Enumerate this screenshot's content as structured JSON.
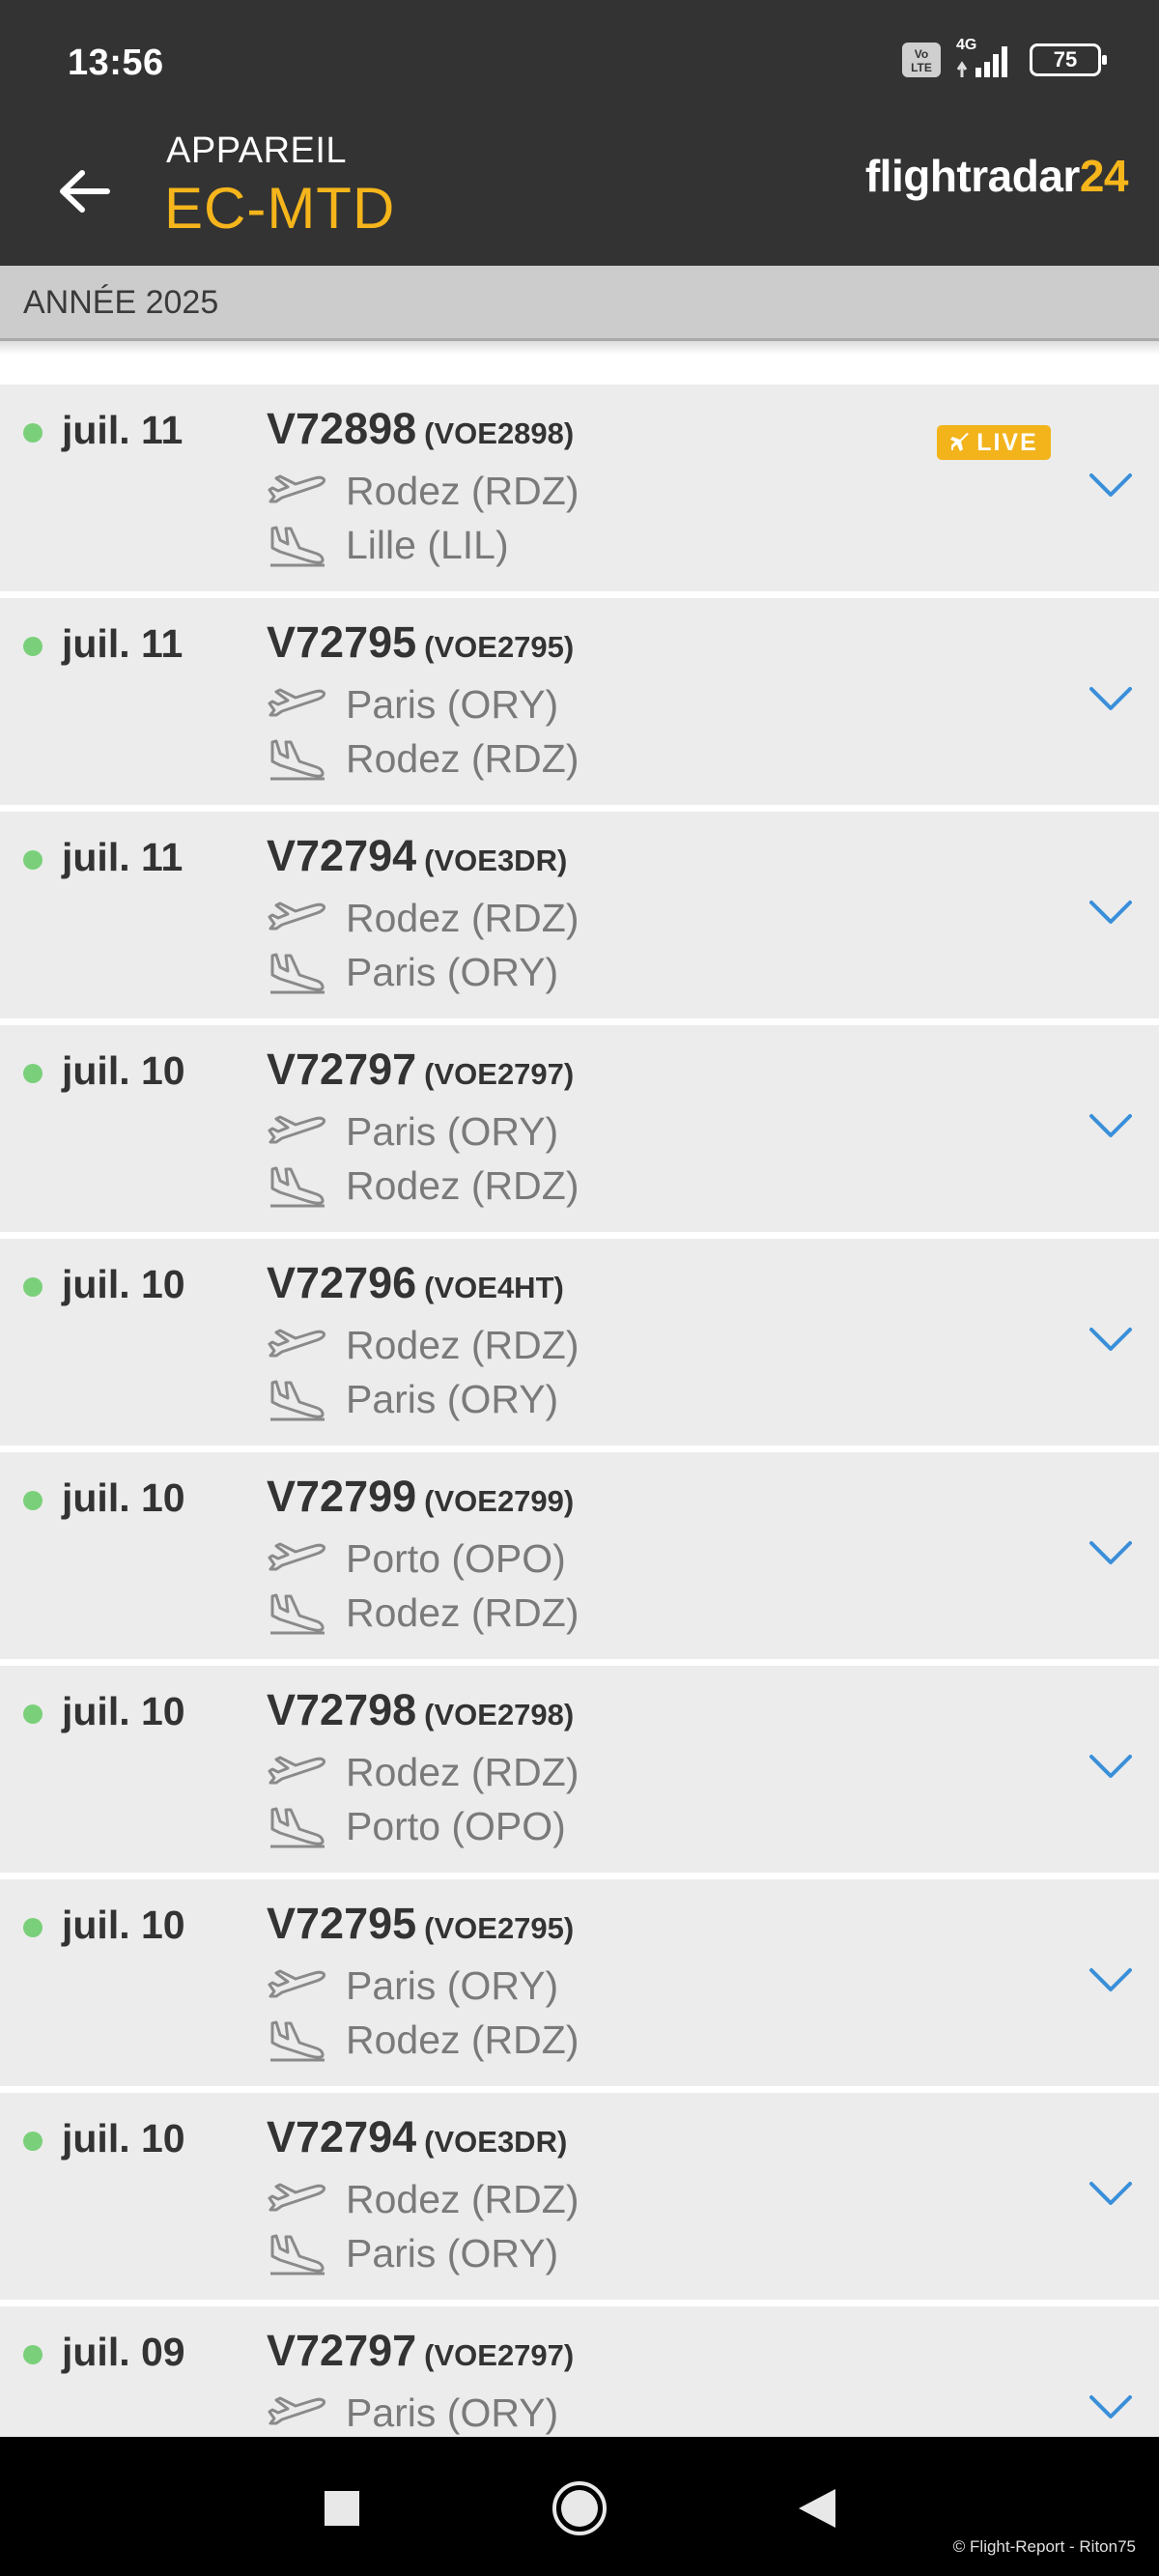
{
  "status_bar": {
    "time": "13:56",
    "volte_top": "Vo",
    "volte_bottom": "LTE",
    "network": "4G",
    "battery": "75"
  },
  "toolbar": {
    "subtitle": "APPAREIL",
    "title": "EC-MTD",
    "brand_text": "flightradar",
    "brand_num": "24",
    "back_icon": "arrow-left-icon"
  },
  "year_header": "ANNÉE 2025",
  "live_label": "LIVE",
  "colors": {
    "bar_bg": "#333333",
    "accent": "#f5b51b",
    "live_badge": "#f2b31b",
    "status_dot": "#7ad07a",
    "chevron": "#3a8fd9",
    "row_bg": "#ececec"
  },
  "flights": [
    {
      "date": "juil. 11",
      "flight": "V72898",
      "callsign": "(VOE2898)",
      "from": "Rodez (RDZ)",
      "to": "Lille (LIL)",
      "live": true
    },
    {
      "date": "juil. 11",
      "flight": "V72795",
      "callsign": "(VOE2795)",
      "from": "Paris (ORY)",
      "to": "Rodez (RDZ)",
      "live": false
    },
    {
      "date": "juil. 11",
      "flight": "V72794",
      "callsign": "(VOE3DR)",
      "from": "Rodez (RDZ)",
      "to": "Paris (ORY)",
      "live": false
    },
    {
      "date": "juil. 10",
      "flight": "V72797",
      "callsign": "(VOE2797)",
      "from": "Paris (ORY)",
      "to": "Rodez (RDZ)",
      "live": false
    },
    {
      "date": "juil. 10",
      "flight": "V72796",
      "callsign": "(VOE4HT)",
      "from": "Rodez (RDZ)",
      "to": "Paris (ORY)",
      "live": false
    },
    {
      "date": "juil. 10",
      "flight": "V72799",
      "callsign": "(VOE2799)",
      "from": "Porto (OPO)",
      "to": "Rodez (RDZ)",
      "live": false
    },
    {
      "date": "juil. 10",
      "flight": "V72798",
      "callsign": "(VOE2798)",
      "from": "Rodez (RDZ)",
      "to": "Porto (OPO)",
      "live": false
    },
    {
      "date": "juil. 10",
      "flight": "V72795",
      "callsign": "(VOE2795)",
      "from": "Paris (ORY)",
      "to": "Rodez (RDZ)",
      "live": false
    },
    {
      "date": "juil. 10",
      "flight": "V72794",
      "callsign": "(VOE3DR)",
      "from": "Rodez (RDZ)",
      "to": "Paris (ORY)",
      "live": false
    },
    {
      "date": "juil. 09",
      "flight": "V72797",
      "callsign": "(VOE2797)",
      "from": "Paris (ORY)",
      "to": "",
      "live": false
    }
  ],
  "icons": {
    "departure": "plane-takeoff-icon",
    "arrival": "plane-landing-icon",
    "expand": "chevron-down-icon",
    "nav_recents": "square-icon",
    "nav_home": "circle-icon",
    "nav_back": "triangle-back-icon"
  },
  "watermark": "© Flight-Report - Riton75"
}
